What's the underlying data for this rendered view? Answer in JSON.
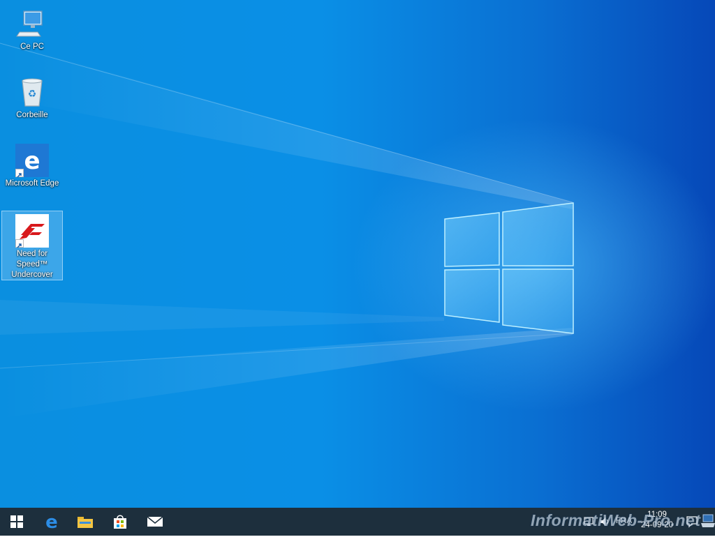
{
  "desktop": {
    "icons": [
      {
        "label": "Ce PC",
        "icon": "computer-icon"
      },
      {
        "label": "Corbeille",
        "icon": "recycle-bin-icon"
      },
      {
        "label": "Microsoft Edge",
        "icon": "edge-icon"
      },
      {
        "label": "Need for Speed™ Undercover",
        "icon": "nfs-undercover-icon",
        "selected": true
      }
    ]
  },
  "taskbar": {
    "pinned": [
      {
        "icon": "start-windows-icon"
      },
      {
        "icon": "edge-icon"
      },
      {
        "icon": "file-explorer-icon"
      },
      {
        "icon": "microsoft-store-icon"
      },
      {
        "icon": "mail-icon"
      }
    ],
    "tray": {
      "language": "FRA",
      "time": "11:09",
      "date": "24-09-20"
    }
  },
  "watermark": "InformatiWeb-Pro.net",
  "colors": {
    "taskbar": "#1d2f3d",
    "wallpaper_light": "#0a8fe0",
    "wallpaper_dark": "#0648b8"
  }
}
